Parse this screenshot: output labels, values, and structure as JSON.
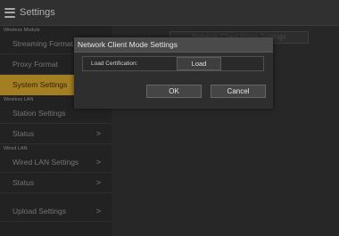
{
  "titlebar": {
    "title": "Settings",
    "menu_icon": "hamburger-menu-icon"
  },
  "background": {
    "ghost_title": "Network Client Mode Settings"
  },
  "sidebar": {
    "sections": [
      {
        "label": "Wireless Module",
        "items": [
          {
            "label": "Streaming Format"
          },
          {
            "label": "Proxy Format"
          },
          {
            "label": "System Settings",
            "active": true
          }
        ]
      },
      {
        "label": "Wireless LAN",
        "items": [
          {
            "label": "Station Settings"
          },
          {
            "label": "Status",
            "chevron": ">"
          }
        ]
      },
      {
        "label": "Wired LAN",
        "items": [
          {
            "label": "Wired LAN Settings",
            "chevron": ">"
          },
          {
            "label": "Status",
            "chevron": ">"
          }
        ]
      },
      {
        "label": "",
        "items": [
          {
            "label": "Upload Settings",
            "chevron": ">"
          }
        ]
      }
    ]
  },
  "dialog": {
    "title": "Network Client Mode Settings",
    "field_label": "Load Certification:",
    "load_button": "Load",
    "ok_button": "OK",
    "cancel_button": "Cancel"
  },
  "colors": {
    "accent": "#c89a2a",
    "background": "#2b2b2b"
  }
}
